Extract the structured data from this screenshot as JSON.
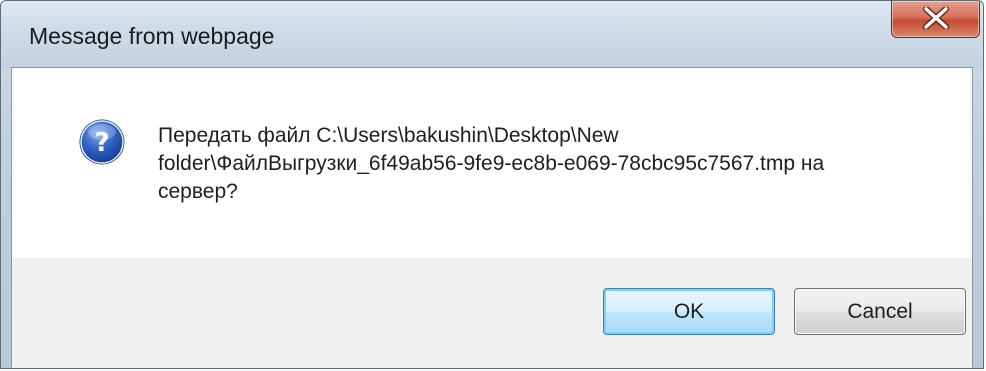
{
  "dialog": {
    "title": "Message from webpage",
    "close_icon": "close-icon",
    "icon": "question-icon",
    "message": "Передать файл C:\\Users\\bakushin\\Desktop\\New\nfolder\\ФайлВыгрузки_6f49ab56-9fe9-ec8b-e069-78cbc95c7567.tmp на\nсервер?",
    "ok_label": "OK",
    "cancel_label": "Cancel"
  },
  "colors": {
    "titlebar": "#c3d2e2",
    "close_button": "#c24a32",
    "button_area": "#f0f0f0",
    "ok_border": "#3c7fb1",
    "question_icon": "#2a5bb8"
  }
}
